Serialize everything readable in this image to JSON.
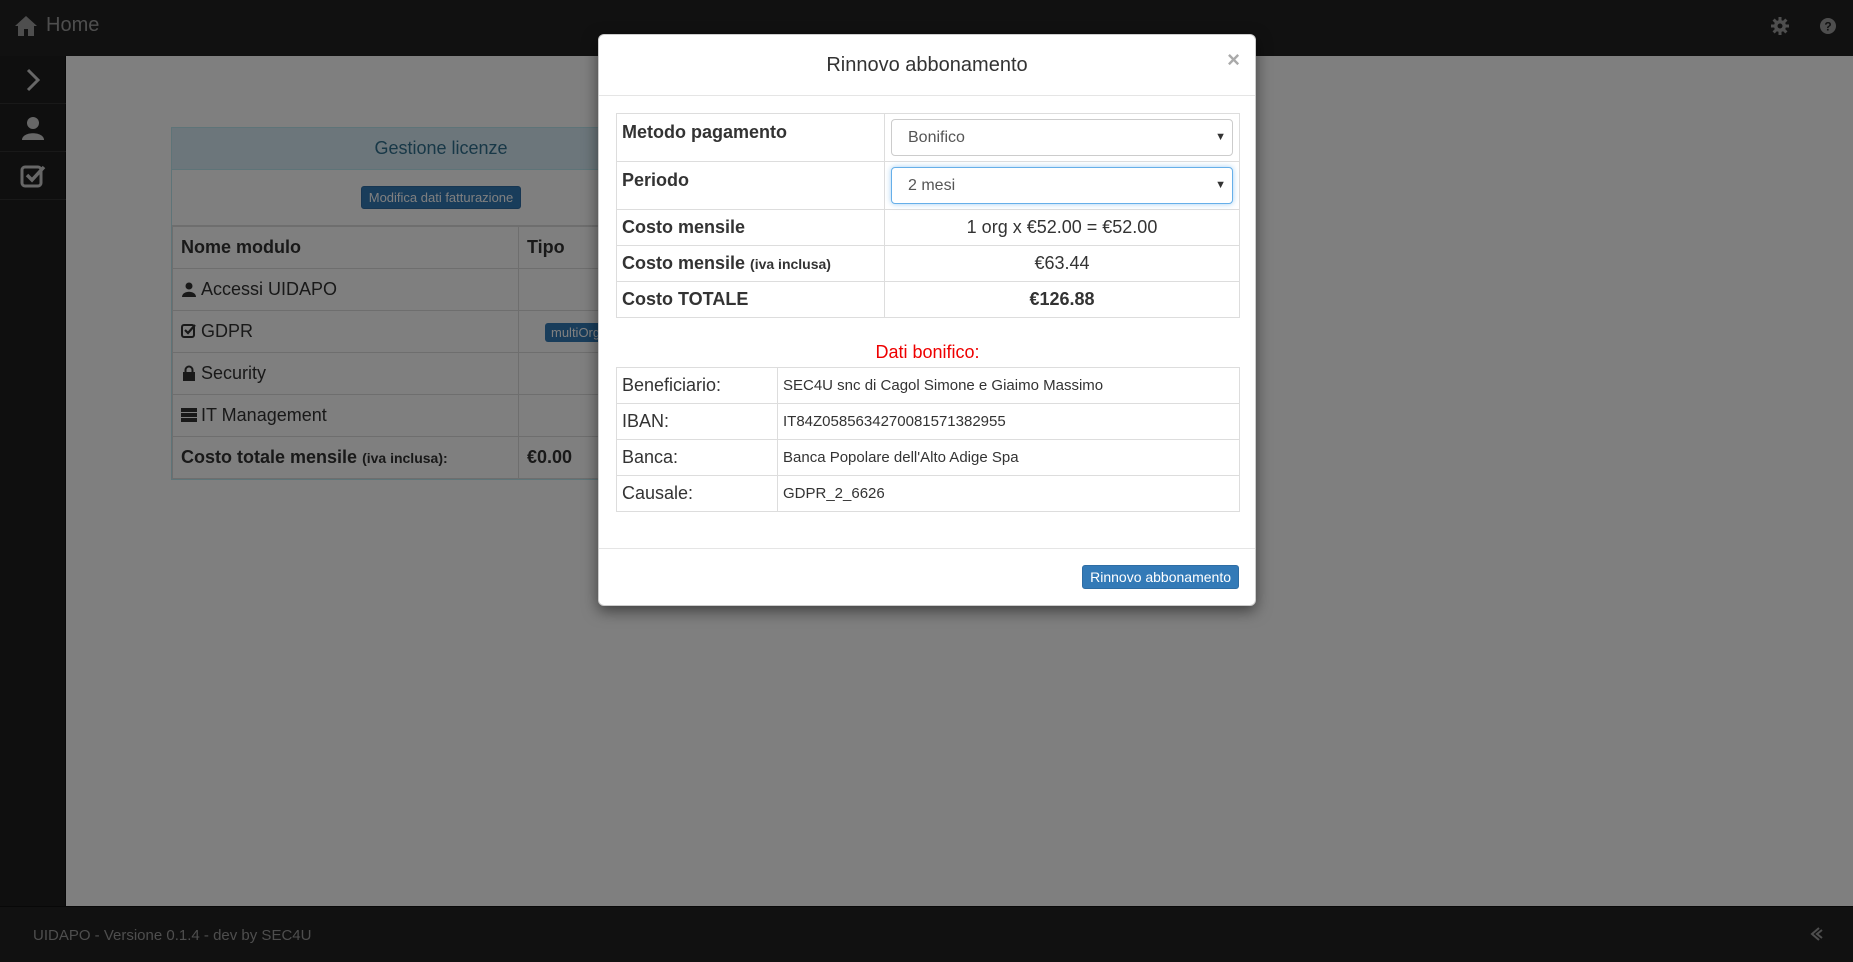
{
  "topbar": {
    "home_label": "Home",
    "icons": [
      "home-icon",
      "gear-icon",
      "help-icon"
    ]
  },
  "sidebar": {
    "items": [
      "chevron-right-icon",
      "user-icon",
      "check-square-icon"
    ]
  },
  "panel": {
    "title": "Gestione licenze",
    "edit_button": "Modifica dati fatturazione",
    "headers": {
      "name": "Nome modulo",
      "type": "Tipo"
    },
    "rows": [
      {
        "icon": "user-icon",
        "name": "Accessi UIDAPO",
        "type": ""
      },
      {
        "icon": "check-square-icon",
        "name": "GDPR",
        "type": "multiOrg"
      },
      {
        "icon": "lock-icon",
        "name": "Security",
        "type": ""
      },
      {
        "icon": "server-icon",
        "name": "IT Management",
        "type": ""
      }
    ],
    "total_label": "Costo totale mensile",
    "total_label_small": "(iva inclusa):",
    "total_value": "€0.00"
  },
  "footer": {
    "text": "UIDAPO - Versione 0.1.4 - dev by SEC4U"
  },
  "modal": {
    "title": "Rinnovo abbonamento",
    "close": "×",
    "payment_method_label": "Metodo pagamento",
    "payment_method_value": "Bonifico",
    "period_label": "Periodo",
    "period_value": "2 mesi",
    "monthly_cost_label": "Costo mensile",
    "monthly_cost_value": "1 org x €52.00 = €52.00",
    "monthly_vat_label": "Costo mensile",
    "monthly_vat_small": "(iva inclusa)",
    "monthly_vat_value": "€63.44",
    "total_label": "Costo TOTALE",
    "total_value": "€126.88",
    "bonifico_title": "Dati bonifico:",
    "bonifico": [
      {
        "label": "Beneficiario:",
        "value": "SEC4U snc di Cagol Simone e Giaimo Massimo"
      },
      {
        "label": "IBAN:",
        "value": "IT84Z0585634270081571382955"
      },
      {
        "label": "Banca:",
        "value": "Banca Popolare dell'Alto Adige Spa"
      },
      {
        "label": "Causale:",
        "value": "GDPR_2_6626"
      }
    ],
    "submit_button": "Rinnovo abbonamento"
  },
  "colors": {
    "primary": "#337ab7",
    "dark_bar": "#222222",
    "danger": "#e00000",
    "info_bg": "#d9edf7"
  }
}
